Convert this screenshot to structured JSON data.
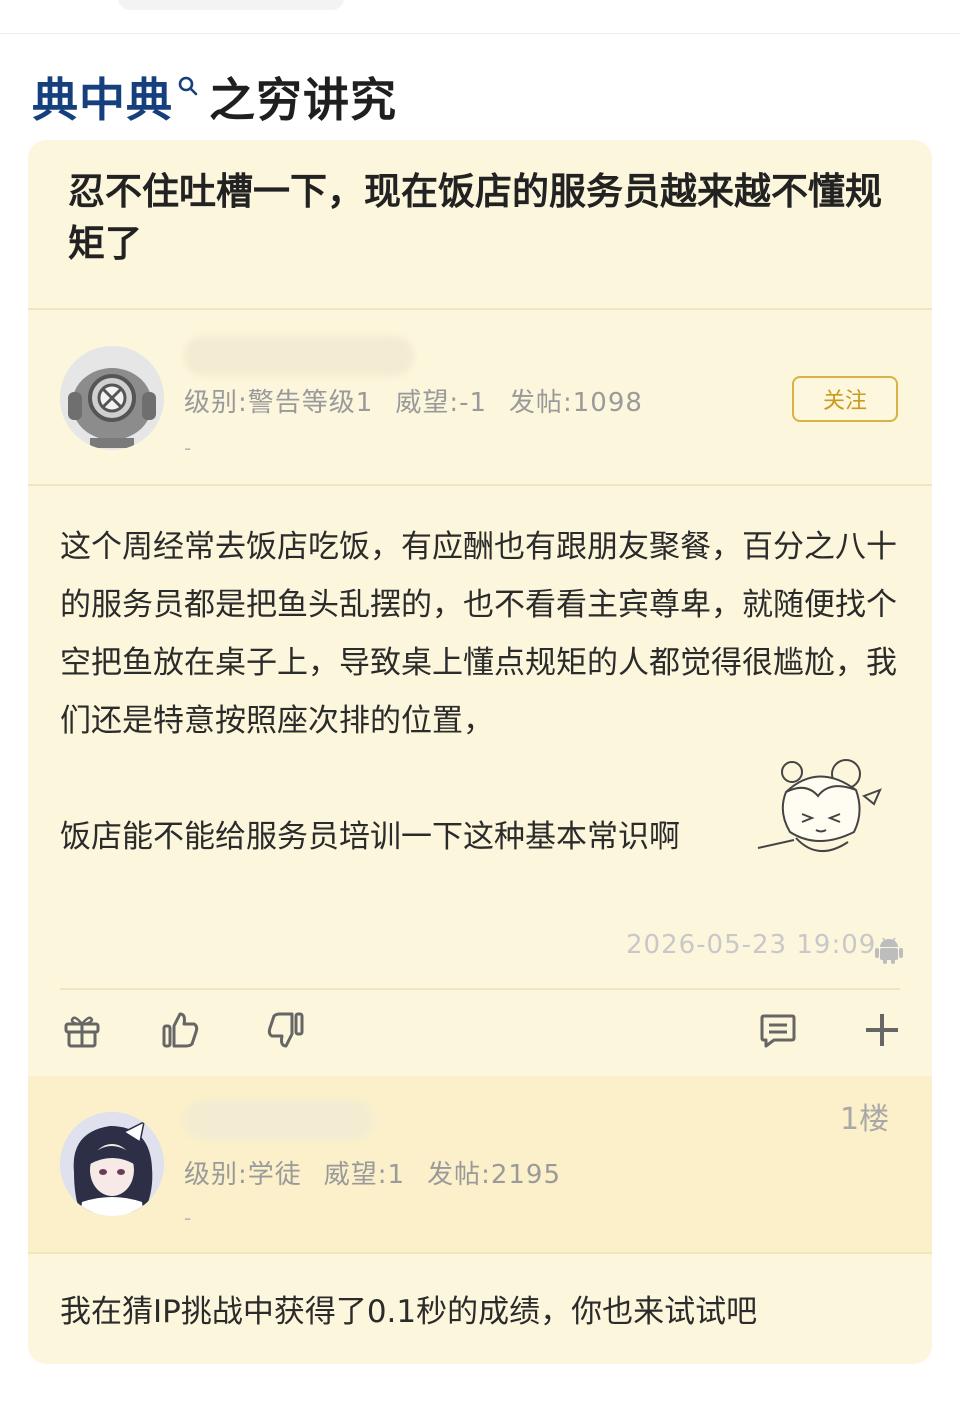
{
  "header": {
    "title_link": "典中典",
    "title_rest": "之穷讲究",
    "search_icon": "search-icon"
  },
  "post": {
    "title": "忍不住吐槽一下，现在饭店的服务员越来越不懂规矩了",
    "author": {
      "avatar_icon": "diving-helmet-avatar",
      "level": "级别:警告等级1",
      "prestige": "威望:-1",
      "posts": "发帖:1098",
      "sub": "-"
    },
    "follow_label": "关注",
    "paragraphs": [
      "这个周经常去饭店吃饭，有应酬也有跟朋友聚餐，百分之八十的服务员都是把鱼头乱摆的，也不看看主宾尊卑，就随便找个空把鱼放在桌子上，导致桌上懂点规矩的人都觉得很尴尬，我们还是特意按照座次排的位置，",
      "饭店能不能给服务员培训一下这种基本常识啊"
    ],
    "timestamp": "2026-05-23 19:09",
    "device_icon": "android-icon",
    "actions": {
      "gift_icon": "gift-icon",
      "like_icon": "thumbs-up-icon",
      "dislike_icon": "thumbs-down-icon",
      "comment_icon": "comment-icon",
      "more_icon": "plus-icon"
    }
  },
  "reply": {
    "floor": "1楼",
    "author": {
      "level": "级别:学徒",
      "prestige": "威望:1",
      "posts": "发帖:2195",
      "sub": "-"
    },
    "text": "我在猜IP挑战中获得了0.1秒的成绩，你也来试试吧"
  },
  "colors": {
    "card_bg": "#fcf6dc",
    "reply_bg": "#fbf0c9",
    "link": "#16407d",
    "follow_border": "#d8b246"
  }
}
